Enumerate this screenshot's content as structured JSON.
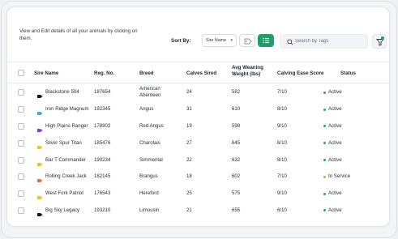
{
  "header": {
    "description": "View and Edit details of all your animals by clicking on them.",
    "sort_label": "Sort By:",
    "sort_value": "Sire Name",
    "search_placeholder": "Search by Tags"
  },
  "colors": {
    "accent": "#1f9d6b",
    "status_active": "#22a868",
    "status_in_service": "#f0a020"
  },
  "table": {
    "columns": [
      "Sire Name",
      "Reg. No.",
      "Breed",
      "Calves Sired",
      "Avg Weaning Weight (lbs)",
      "Calving Ease Score",
      "Status"
    ],
    "rows": [
      {
        "sire": "Blackstone 504",
        "reg": "187654",
        "breed": "American Aberdeen",
        "calves": "24",
        "weight": "582",
        "ease": "7/10",
        "status": "Active",
        "icon_color": "#1a1a1a"
      },
      {
        "sire": "Iron Ridge Magnum",
        "reg": "192345",
        "breed": "Angus",
        "calves": "31",
        "weight": "610",
        "ease": "8/10",
        "status": "Active",
        "icon_color": "#4aa3df"
      },
      {
        "sire": "High Plains Ranger",
        "reg": "178902",
        "breed": "Red Angus",
        "calves": "19",
        "weight": "598",
        "ease": "9/10",
        "status": "Active",
        "icon_color": "#8b3fc7"
      },
      {
        "sire": "Silver Spur Titan",
        "reg": "185476",
        "breed": "Charolais",
        "calves": "27",
        "weight": "645",
        "ease": "6/10",
        "status": "Active",
        "icon_color": "#f2c12e"
      },
      {
        "sire": "Bar T Commander",
        "reg": "190234",
        "breed": "Simmental",
        "calves": "22",
        "weight": "632",
        "ease": "8/10",
        "status": "Active",
        "icon_color": "#f2c12e"
      },
      {
        "sire": "Rolling Creek Jack",
        "reg": "182145",
        "breed": "Brangus",
        "calves": "18",
        "weight": "602",
        "ease": "7/10",
        "status": "In Service",
        "icon_color": "#e8743b"
      },
      {
        "sire": "West Fork Patriot",
        "reg": "176543",
        "breed": "Hereford",
        "calves": "25",
        "weight": "575",
        "ease": "9/10",
        "status": "Active",
        "icon_color": "#f2c12e"
      },
      {
        "sire": "Big Sky Legacy",
        "reg": "193210",
        "breed": "Limousin",
        "calves": "21",
        "weight": "655",
        "ease": "6/10",
        "status": "Active",
        "icon_color": "#1a1a1a"
      }
    ]
  }
}
